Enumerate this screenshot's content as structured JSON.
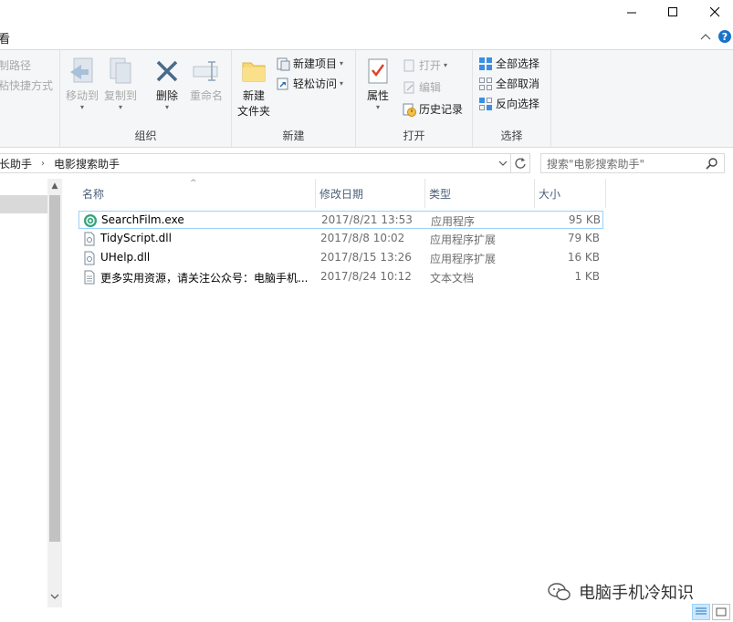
{
  "window": {
    "menu_tab_fragment": "看"
  },
  "ribbon": {
    "clipboard": {
      "copy_path": "制路径",
      "paste_shortcut": "粘快捷方式"
    },
    "organize": {
      "label": "组织",
      "move_to": "移动到",
      "copy_to": "复制到",
      "delete": "删除",
      "rename": "重命名"
    },
    "new": {
      "label": "新建",
      "new_folder": "新建\n文件夹",
      "new_item": "新建项目",
      "easy_access": "轻松访问"
    },
    "open": {
      "label": "打开",
      "properties": "属性",
      "open": "打开",
      "edit": "编辑",
      "history": "历史记录"
    },
    "select": {
      "label": "选择",
      "select_all": "全部选择",
      "select_none": "全部取消",
      "invert": "反向选择"
    }
  },
  "address": {
    "crumb_parent": "长助手",
    "crumb_current": "电影搜索助手",
    "search_placeholder": "搜索\"电影搜索助手\""
  },
  "columns": {
    "name": "名称",
    "date": "修改日期",
    "type": "类型",
    "size": "大小"
  },
  "files": [
    {
      "name": "SearchFilm.exe",
      "date": "2017/8/21 13:53",
      "type": "应用程序",
      "size": "95 KB",
      "icon": "app-icon"
    },
    {
      "name": "TidyScript.dll",
      "date": "2017/8/8 10:02",
      "type": "应用程序扩展",
      "size": "79 KB",
      "icon": "dll-icon"
    },
    {
      "name": "UHelp.dll",
      "date": "2017/8/15 13:26",
      "type": "应用程序扩展",
      "size": "16 KB",
      "icon": "dll-icon"
    },
    {
      "name": "更多实用资源，请关注公众号：电脑手机...",
      "date": "2017/8/24 10:12",
      "type": "文本文档",
      "size": "1 KB",
      "icon": "text-file-icon"
    }
  ],
  "watermark": {
    "text": "电脑手机冷知识"
  },
  "colors": {
    "accent": "#0078d7",
    "selection_border": "#99d1ff",
    "column_header": "#4c607a"
  }
}
